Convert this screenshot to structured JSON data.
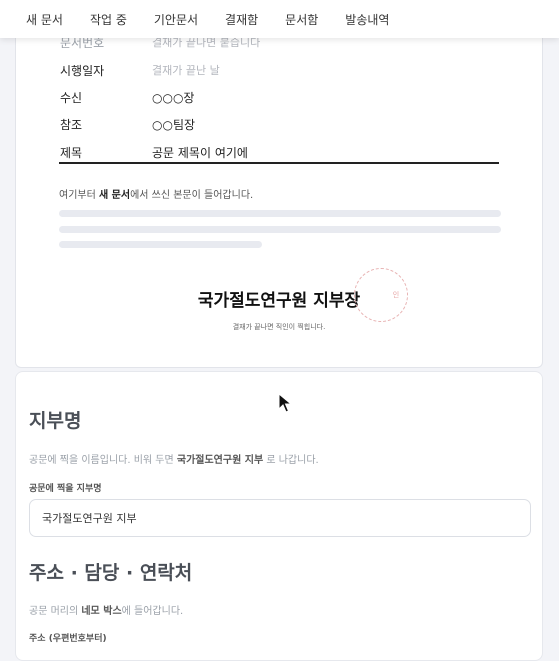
{
  "nav": [
    "새 문서",
    "작업 중",
    "기안문서",
    "결재함",
    "문서함",
    "발송내역"
  ],
  "document": {
    "fields": [
      {
        "label": "문서번호",
        "value": "결재가 끝나면 붙습니다",
        "muted": true
      },
      {
        "label": "시행일자",
        "value": "결재가 끝난 날",
        "muted": true
      },
      {
        "label": "수신",
        "value": "○○○장",
        "muted": false
      },
      {
        "label": "참조",
        "value": "○○팀장",
        "muted": false
      },
      {
        "label": "제목",
        "value": "공문 제목이 여기에",
        "muted": false
      }
    ],
    "body_note": {
      "prefix": "여기부터 ",
      "bold": "새 문서",
      "suffix": "에서 쓰신 본문이 들어갑니다."
    },
    "sender_name": "국가절도연구원 지부장",
    "seal_text": "인",
    "sign_note": "결재가 끝나면 직인이 찍힙니다."
  },
  "branch_section": {
    "title": "지부명",
    "desc": {
      "prefix": "공문에 찍을 이름입니다. 비워 두면 ",
      "bold": "국가절도연구원 지부",
      "suffix": " 로 나갑니다."
    },
    "field_label": "공문에 찍을 지부명",
    "field_value": "국가절도연구원 지부"
  },
  "contact_section": {
    "title": "주소 · 담당 · 연락처",
    "desc": {
      "prefix": "공문 머리의 ",
      "bold": "네모 박스",
      "suffix": "에 들어갑니다."
    },
    "field_label": "주소 (우편번호부터)"
  }
}
